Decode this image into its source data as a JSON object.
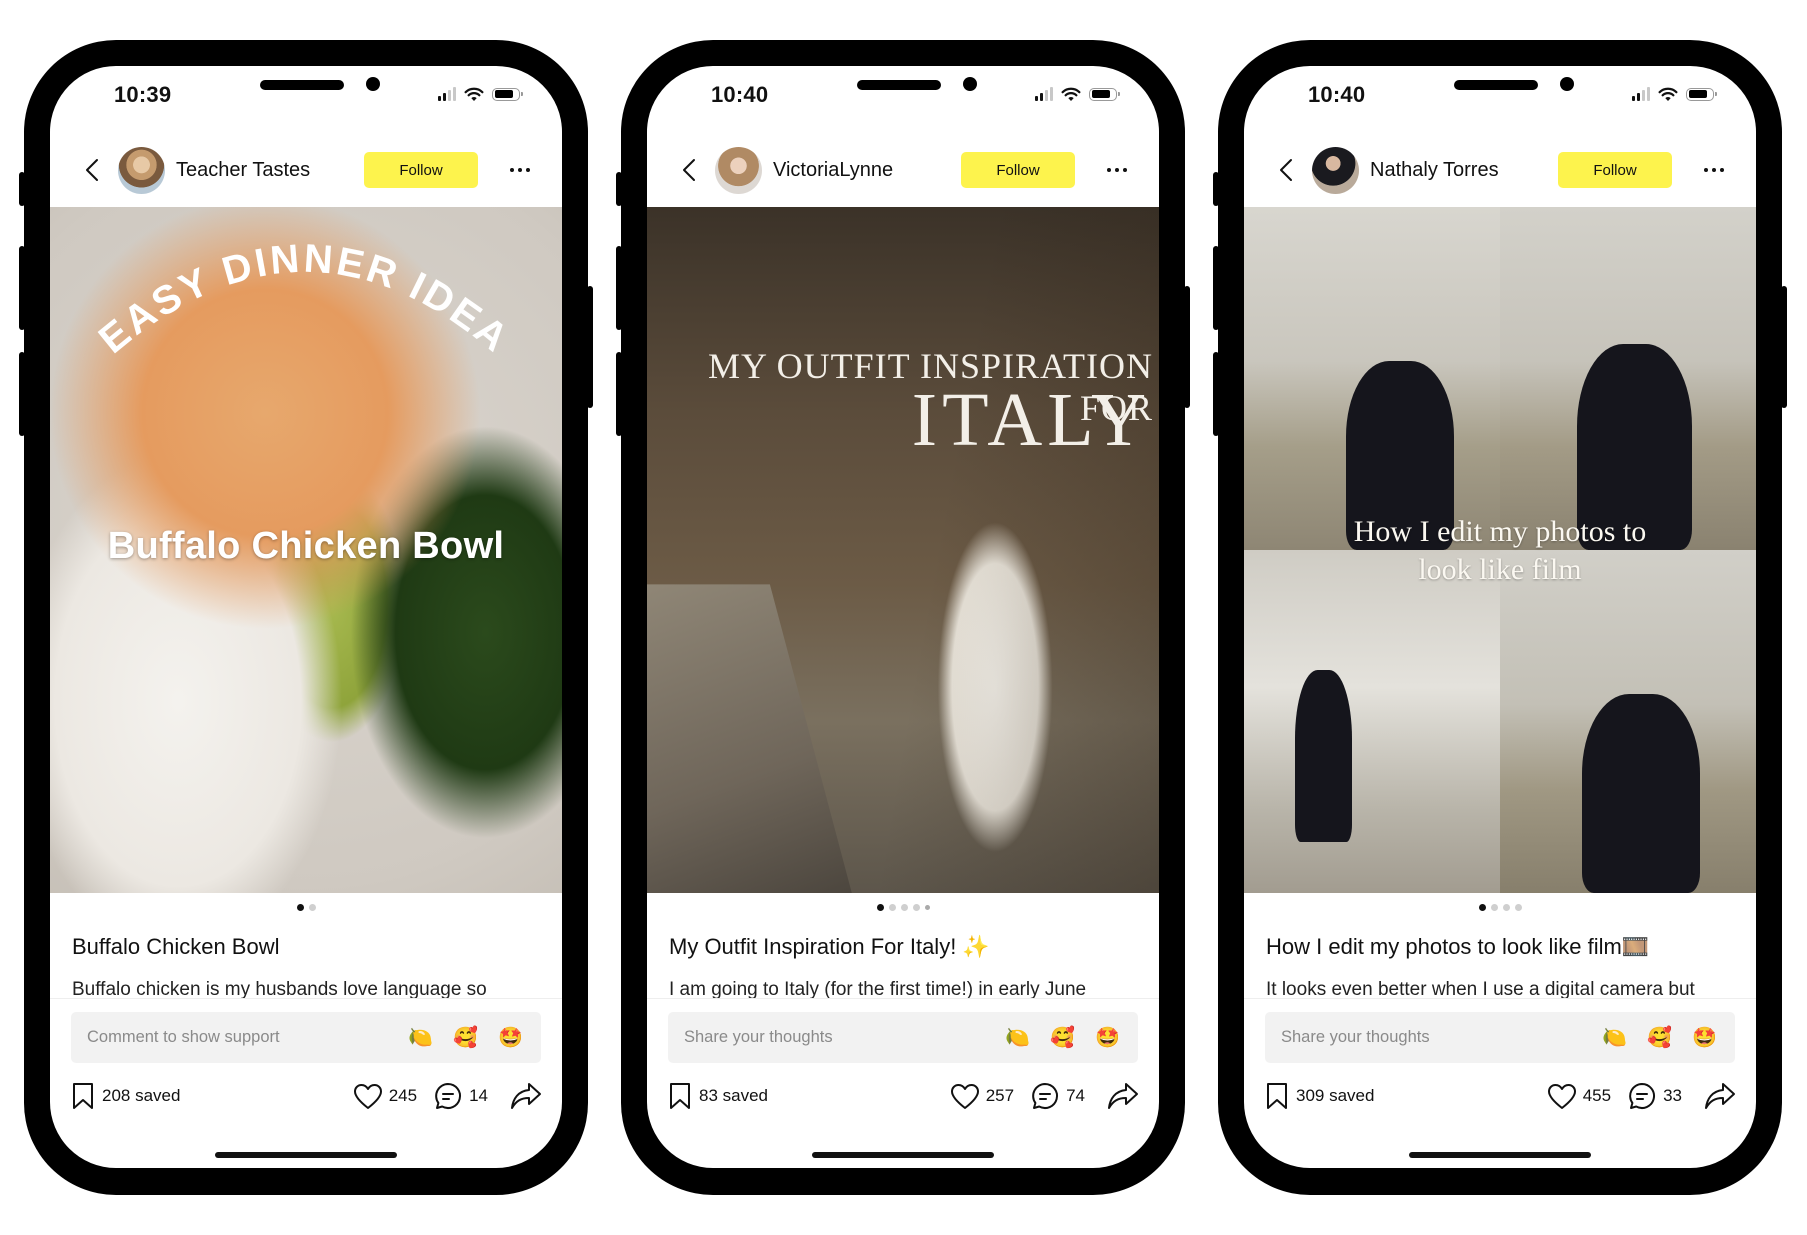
{
  "phones": [
    {
      "status": {
        "time": "10:39"
      },
      "header": {
        "username": "Teacher Tastes",
        "follow_label": "Follow"
      },
      "image": {
        "overlay_top": "EASY DINNER IDEA",
        "overlay_main": "Buffalo Chicken Bowl",
        "slide_count": 2,
        "active_slide": 1
      },
      "post": {
        "title": "Buffalo Chicken Bowl",
        "description": "Buffalo chicken is my husbands love language so"
      },
      "comment": {
        "placeholder": "Comment to show support",
        "emojis": [
          "🍋",
          "🥰",
          "🤩"
        ]
      },
      "stats": {
        "saved": "208 saved",
        "likes": "245",
        "comments": "14"
      }
    },
    {
      "status": {
        "time": "10:40"
      },
      "header": {
        "username": "VictoriaLynne",
        "follow_label": "Follow"
      },
      "image": {
        "overlay_top": "MY OUTFIT INSPIRATION FOR",
        "overlay_main": "ITALY",
        "slide_count": 5,
        "active_slide": 1
      },
      "post": {
        "title": "My Outfit Inspiration For Italy! ✨",
        "description": "I am going to Italy (for the first time!) in early June"
      },
      "comment": {
        "placeholder": "Share your thoughts",
        "emojis": [
          "🍋",
          "🥰",
          "🤩"
        ]
      },
      "stats": {
        "saved": "83 saved",
        "likes": "257",
        "comments": "74"
      }
    },
    {
      "status": {
        "time": "10:40"
      },
      "header": {
        "username": "Nathaly Torres",
        "follow_label": "Follow"
      },
      "image": {
        "overlay_line1": "How I edit my photos to",
        "overlay_line2": "look like film",
        "slide_count": 4,
        "active_slide": 1
      },
      "post": {
        "title": "How I edit my photos to look like film🎞️",
        "description": "It looks even better when I use a digital camera but"
      },
      "comment": {
        "placeholder": "Share your thoughts",
        "emojis": [
          "🍋",
          "🥰",
          "🤩"
        ]
      },
      "stats": {
        "saved": "309 saved",
        "likes": "455",
        "comments": "33"
      }
    }
  ],
  "colors": {
    "follow_button": "#fdf34d",
    "comment_box": "#f2f2f2",
    "phone_frame": "#000000",
    "text_primary": "#111111",
    "placeholder": "#8a8a8a"
  },
  "icons": {
    "back": "chevron-left-icon",
    "more": "more-horizontal-icon",
    "save": "bookmark-icon",
    "like": "heart-icon",
    "comment": "comment-bubble-icon",
    "share": "share-arrow-icon",
    "signal": "cellular-signal-icon",
    "wifi": "wifi-icon",
    "battery": "battery-icon"
  }
}
